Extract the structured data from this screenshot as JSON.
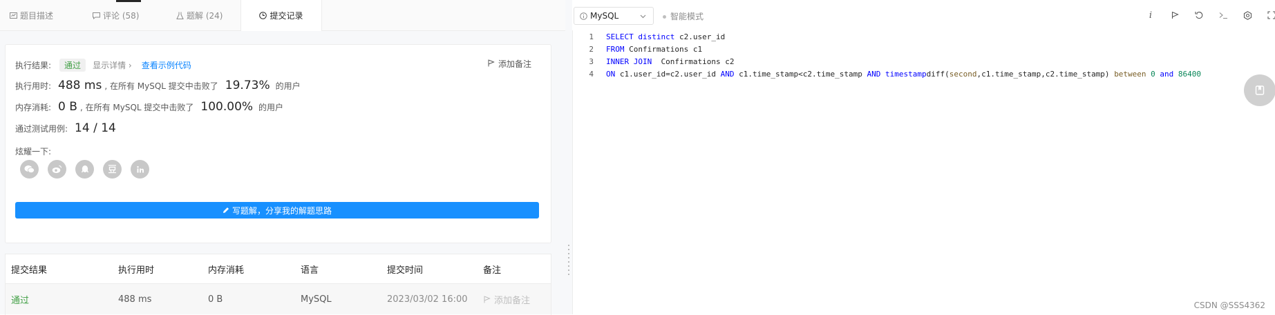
{
  "tabs": [
    {
      "label": "题目描述",
      "icon": "description-icon"
    },
    {
      "label": "评论 (58)",
      "icon": "comment-icon"
    },
    {
      "label": "题解 (24)",
      "icon": "flask-icon"
    },
    {
      "label": "提交记录",
      "icon": "clock-icon"
    }
  ],
  "result": {
    "label": "执行结果:",
    "status": "通过",
    "details_link": "显示详情 ›",
    "sample_link": "查看示例代码",
    "add_note": "添加备注"
  },
  "runtime": {
    "label": "执行用时:",
    "value": "488 ms",
    "text1": ", 在所有 MySQL 提交中击败了",
    "percent": "19.73%",
    "text2": "的用户"
  },
  "memory": {
    "label": "内存消耗:",
    "value": "0 B",
    "text1": ", 在所有 MySQL 提交中击败了",
    "percent": "100.00%",
    "text2": "的用户"
  },
  "testcases": {
    "label": "通过测试用例:",
    "value": "14 / 14"
  },
  "share": {
    "label": "炫耀一下:",
    "icons": [
      "wechat-icon",
      "weibo-icon",
      "qq-icon",
      "douban-icon",
      "linkedin-icon"
    ]
  },
  "write_button": "写题解，分享我的解题思路",
  "table": {
    "headers": [
      "提交结果",
      "执行用时",
      "内存消耗",
      "语言",
      "提交时间",
      "备注"
    ],
    "rows": [
      {
        "status": "通过",
        "runtime": "488 ms",
        "memory": "0 B",
        "language": "MySQL",
        "time": "2023/03/02 16:00",
        "note": "添加备注"
      }
    ]
  },
  "editor": {
    "language": "MySQL",
    "smart_mode": "智能模式",
    "lines": [
      "1",
      "2",
      "3",
      "4"
    ]
  },
  "watermark": "CSDN @SSS4362",
  "colors": {
    "accent": "#1890ff",
    "pass": "#43a047",
    "keyword": "#0000ff",
    "function": "#795e26",
    "number": "#098658"
  }
}
